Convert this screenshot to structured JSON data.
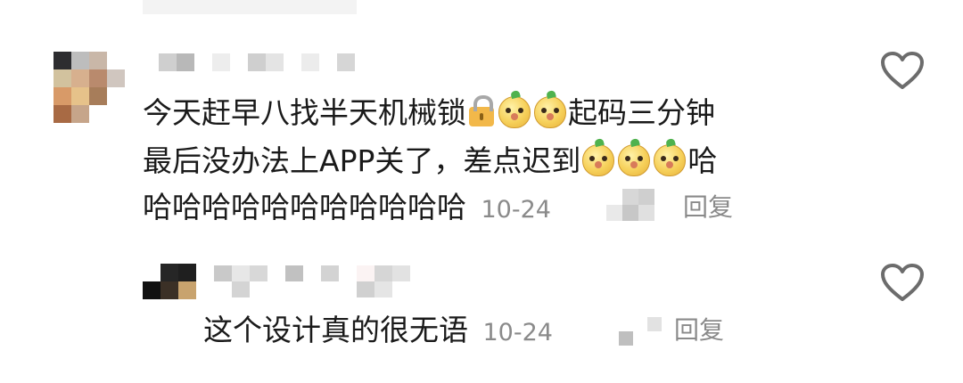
{
  "comments": [
    {
      "line1_a": "今天赶早八找半天机械锁",
      "line1_b": "起码三分钟",
      "line2_a": "最后没办法上APP关了，差点迟到",
      "line2_b": "哈",
      "line3": "哈哈哈哈哈哈哈哈哈哈哈",
      "date": "10-24",
      "reply_label": "回复",
      "icons": [
        "lock-icon",
        "meerkat-emoji-icon",
        "meerkat-emoji-icon",
        "meerkat-emoji-icon",
        "meerkat-emoji-icon",
        "meerkat-emoji-icon",
        "heart-outline-icon"
      ]
    },
    {
      "text": "这个设计真的很无语",
      "date": "10-24",
      "reply_label": "回复",
      "icons": [
        "heart-outline-icon"
      ]
    }
  ]
}
